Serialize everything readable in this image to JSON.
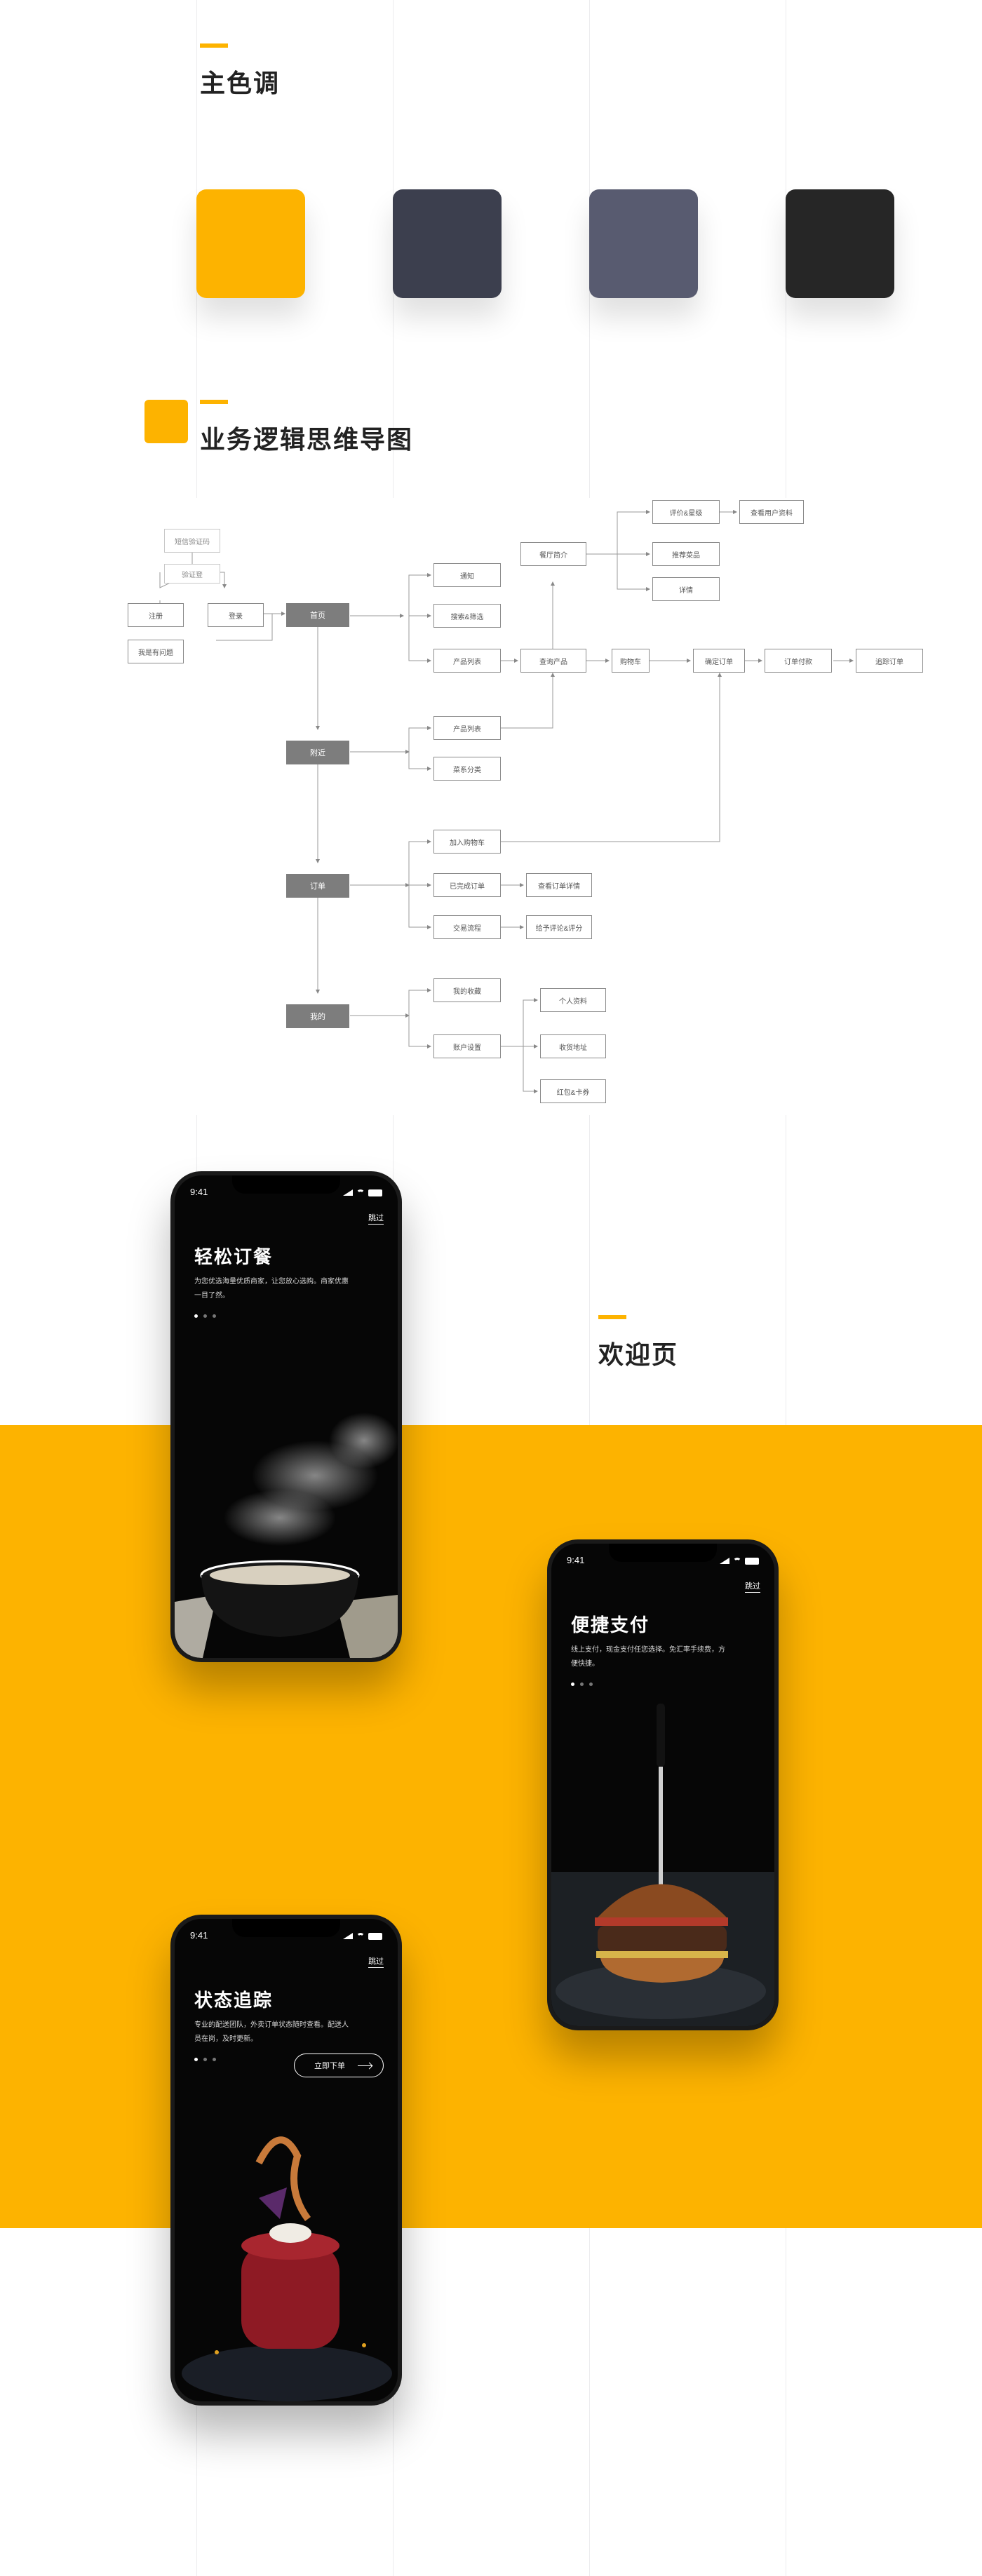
{
  "colors": {
    "accent": "#FDB300",
    "swatches": [
      "#FDB300",
      "#3C3F4E",
      "#585B70",
      "#262626"
    ]
  },
  "sections": {
    "main_colors_title": "主色调",
    "mindmap_title": "业务逻辑思维导图",
    "welcome_title": "欢迎页"
  },
  "mindmap": {
    "nodes": {
      "login_phone": "短信验证码",
      "register": "验证登",
      "signup": "注册",
      "login": "登录",
      "forgot": "我是有问题",
      "home": "首页",
      "nearby": "附近",
      "orders": "订单",
      "mine": "我的",
      "notify": "通知",
      "search": "搜索&筛选",
      "product_list": "产品列表",
      "restaurant": "餐厅简介",
      "product_detail": "查询产品",
      "cart": "购物车",
      "confirm_order": "确定订单",
      "pay_order": "订单付款",
      "track_order": "追踪订单",
      "review": "评价&星级",
      "view_profile": "查看用户资料",
      "recommend": "推荐菜品",
      "detail": "详情",
      "nearby_list": "产品列表",
      "category": "菜系分类",
      "add_cart": "加入购物车",
      "done_orders": "已完成订单",
      "view_order": "查看订单详情",
      "trading": "交易流程",
      "rate": "给予评论&评分",
      "my_fav": "我的收藏",
      "account": "账户设置",
      "profile": "个人资料",
      "address": "收货地址",
      "card": "红包&卡券"
    }
  },
  "phones": [
    {
      "time": "9:41",
      "skip": "跳过",
      "title": "轻松订餐",
      "desc": "为您优选海量优质商家，让您放心选购。商家优惠一目了然。"
    },
    {
      "time": "9:41",
      "skip": "跳过",
      "title": "便捷支付",
      "desc": "线上支付，现金支付任您选择。免汇率手续费，方便快捷。"
    },
    {
      "time": "9:41",
      "skip": "跳过",
      "title": "状态追踪",
      "desc": "专业的配送团队，外卖订单状态随时查看。配送人员在岗，及时更新。",
      "button": "立即下单"
    }
  ]
}
